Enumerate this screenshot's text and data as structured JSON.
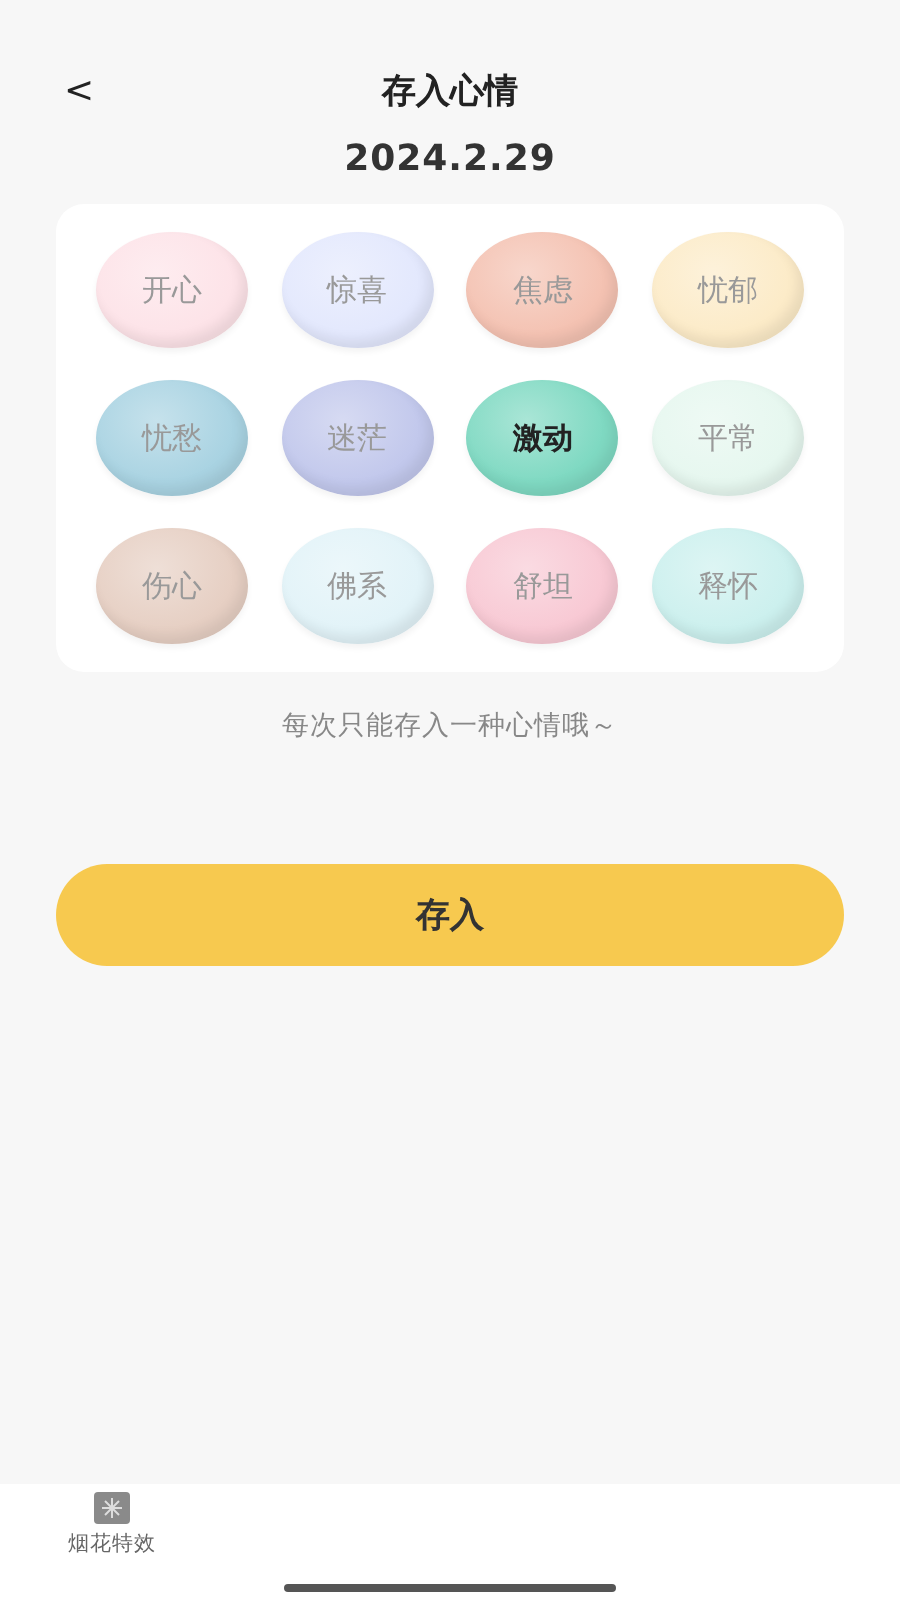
{
  "header": {
    "back": "<",
    "title": "存入心情"
  },
  "date": "2024.2.29",
  "moods": [
    {
      "label": "开心",
      "color": "#fde3e8",
      "selected": false
    },
    {
      "label": "惊喜",
      "color": "#e3e8fd",
      "selected": false
    },
    {
      "label": "焦虑",
      "color": "#f4c2b2",
      "selected": false
    },
    {
      "label": "忧郁",
      "color": "#fcebc8",
      "selected": false
    },
    {
      "label": "忧愁",
      "color": "#a9d3e2",
      "selected": false
    },
    {
      "label": "迷茫",
      "color": "#c2c8ec",
      "selected": false
    },
    {
      "label": "激动",
      "color": "#7fd9c2",
      "selected": true
    },
    {
      "label": "平常",
      "color": "#e6f7ef",
      "selected": false
    },
    {
      "label": "伤心",
      "color": "#e6cfc3",
      "selected": false
    },
    {
      "label": "佛系",
      "color": "#e2f3f8",
      "selected": false
    },
    {
      "label": "舒坦",
      "color": "#f8c9d4",
      "selected": false
    },
    {
      "label": "释怀",
      "color": "#ccf0ee",
      "selected": false
    }
  ],
  "hint": "每次只能存入一种心情哦～",
  "save_button": "存入",
  "tab_bar": [
    {
      "label": "烟花特效"
    }
  ]
}
